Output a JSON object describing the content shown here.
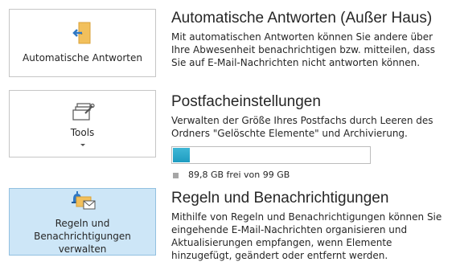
{
  "tiles": {
    "auto": {
      "label": "Automatische Antworten",
      "icon": "door-arrow-icon"
    },
    "tools": {
      "label": "Tools",
      "icon": "mailbox-tools-icon"
    },
    "rules": {
      "label_line1": "Regeln und",
      "label_line2": "Benachrichtigungen verwalten",
      "icon": "rules-notifications-icon"
    }
  },
  "sections": {
    "auto": {
      "title": "Automatische Antworten (Außer Haus)",
      "description": "Mit automatischen Antworten können Sie andere über Ihre Abwesenheit benachrichtigen bzw. mitteilen, dass Sie auf E-Mail-Nachrichten nicht antworten können."
    },
    "postfach": {
      "title": "Postfacheinstellungen",
      "description": "Verwalten der Größe Ihres Postfachs durch Leeren des Ordners \"Gelöschte Elemente\" und Archivierung.",
      "usage_fraction": 0.09,
      "storage_text": "89,8 GB frei von 99 GB"
    },
    "rules": {
      "title": "Regeln und Benachrichtigungen",
      "description": "Mithilfe von Regeln und Benachrichtigungen können Sie eingehende E-Mail-Nachrichten organisieren und Aktualisierungen empfangen, wenn Elemente hinzugefügt, geändert oder entfernt werden."
    }
  },
  "colors": {
    "selected_tile": "#cde6f7",
    "progress_fill": "#1e9cc0"
  }
}
